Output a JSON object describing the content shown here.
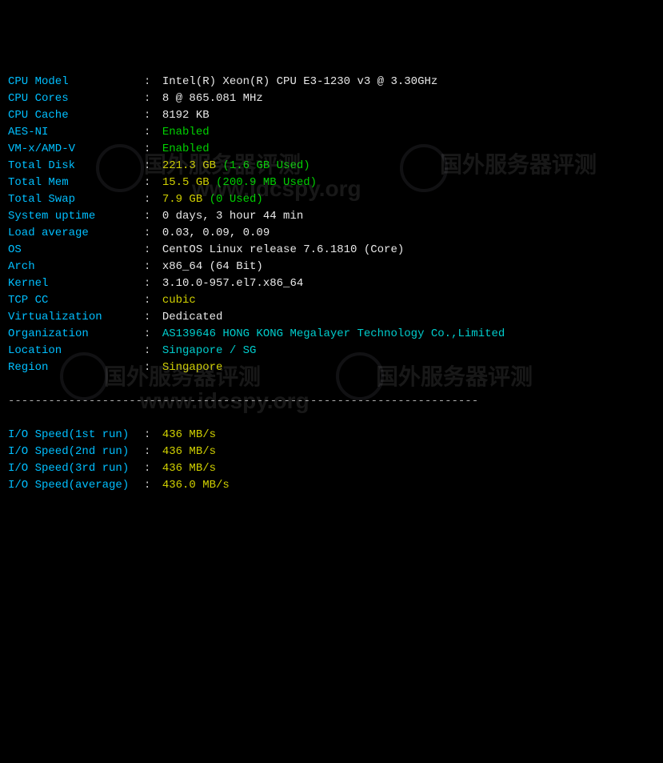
{
  "rows": [
    {
      "label": "CPU Model",
      "parts": [
        {
          "cls": "val-white",
          "text": "Intel(R) Xeon(R) CPU E3-1230 v3 @ 3.30GHz"
        }
      ]
    },
    {
      "label": "CPU Cores",
      "parts": [
        {
          "cls": "val-white",
          "text": "8 @ 865.081 MHz"
        }
      ]
    },
    {
      "label": "CPU Cache",
      "parts": [
        {
          "cls": "val-white",
          "text": "8192 KB"
        }
      ]
    },
    {
      "label": "AES-NI",
      "parts": [
        {
          "cls": "val-green",
          "text": "Enabled"
        }
      ]
    },
    {
      "label": "VM-x/AMD-V",
      "parts": [
        {
          "cls": "val-green",
          "text": "Enabled"
        }
      ]
    },
    {
      "label": "Total Disk",
      "parts": [
        {
          "cls": "val-yellow",
          "text": "221.3 GB "
        },
        {
          "cls": "paren",
          "text": "(1.6 GB Used)"
        }
      ]
    },
    {
      "label": "Total Mem",
      "parts": [
        {
          "cls": "val-yellow",
          "text": "15.5 GB "
        },
        {
          "cls": "paren",
          "text": "(200.9 MB Used)"
        }
      ]
    },
    {
      "label": "Total Swap",
      "parts": [
        {
          "cls": "val-yellow",
          "text": "7.9 GB "
        },
        {
          "cls": "paren",
          "text": "(0 Used)"
        }
      ]
    },
    {
      "label": "System uptime",
      "parts": [
        {
          "cls": "val-white",
          "text": "0 days, 3 hour 44 min"
        }
      ]
    },
    {
      "label": "Load average",
      "parts": [
        {
          "cls": "val-white",
          "text": "0.03, 0.09, 0.09"
        }
      ]
    },
    {
      "label": "OS",
      "parts": [
        {
          "cls": "val-white",
          "text": "CentOS Linux release 7.6.1810 (Core)"
        }
      ]
    },
    {
      "label": "Arch",
      "parts": [
        {
          "cls": "val-white",
          "text": "x86_64 (64 Bit)"
        }
      ]
    },
    {
      "label": "Kernel",
      "parts": [
        {
          "cls": "val-white",
          "text": "3.10.0-957.el7.x86_64"
        }
      ]
    },
    {
      "label": "TCP CC",
      "parts": [
        {
          "cls": "val-yellow",
          "text": "cubic"
        }
      ]
    },
    {
      "label": "Virtualization",
      "parts": [
        {
          "cls": "val-white",
          "text": "Dedicated"
        }
      ]
    },
    {
      "label": "Organization",
      "parts": [
        {
          "cls": "val-cyan",
          "text": "AS139646 HONG KONG Megalayer Technology Co.,Limited"
        }
      ]
    },
    {
      "label": "Location",
      "parts": [
        {
          "cls": "val-cyan",
          "text": "Singapore / SG"
        }
      ]
    },
    {
      "label": "Region",
      "parts": [
        {
          "cls": "val-yellow",
          "text": "Singapore"
        }
      ]
    }
  ],
  "divider": "----------------------------------------------------------------------",
  "io_rows": [
    {
      "label": "I/O Speed(1st run)",
      "parts": [
        {
          "cls": "val-yellow",
          "text": "436 MB/s"
        }
      ]
    },
    {
      "label": "I/O Speed(2nd run)",
      "parts": [
        {
          "cls": "val-yellow",
          "text": "436 MB/s"
        }
      ]
    },
    {
      "label": "I/O Speed(3rd run)",
      "parts": [
        {
          "cls": "val-yellow",
          "text": "436 MB/s"
        }
      ]
    },
    {
      "label": "I/O Speed(average)",
      "parts": [
        {
          "cls": "val-yellow",
          "text": "436.0 MB/s"
        }
      ]
    }
  ],
  "watermarks": {
    "cn": "国外服务器评测",
    "url": "www.idcspy.org"
  }
}
